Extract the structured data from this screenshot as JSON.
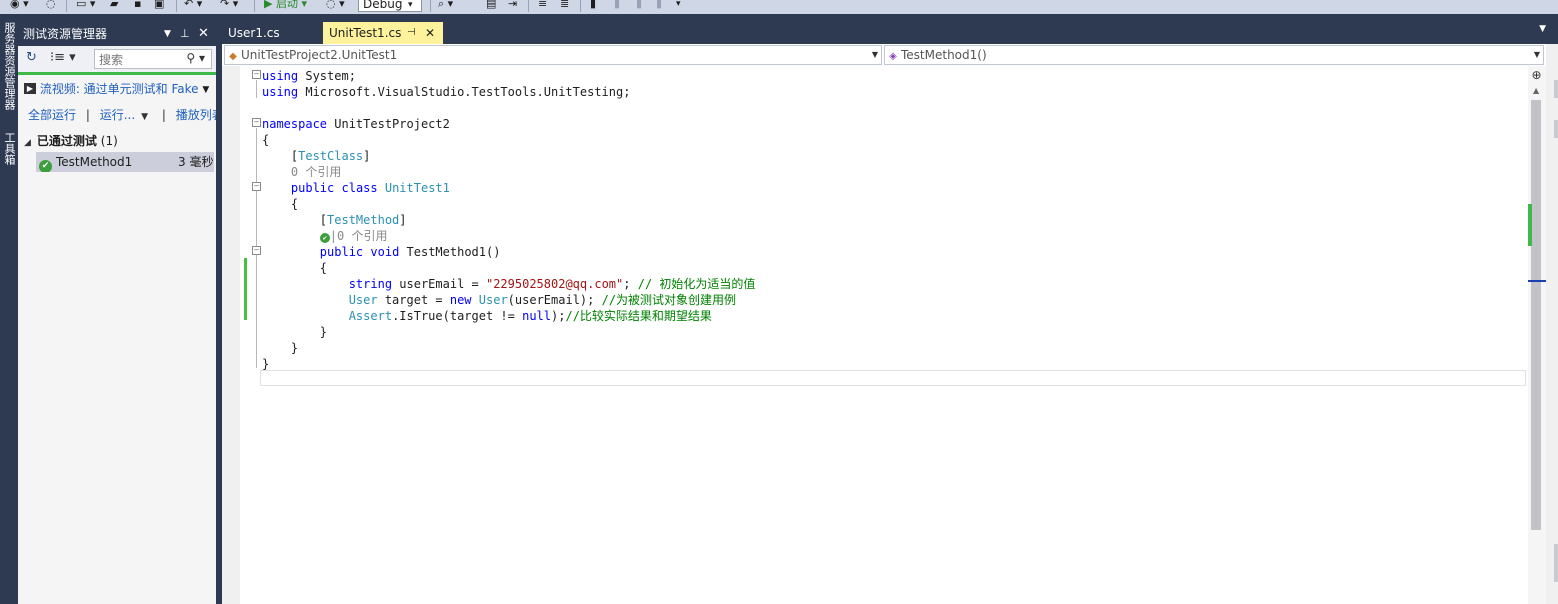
{
  "toolbar": {
    "start_label": "▶ 启动 ▾",
    "config_value": "Debug",
    "icons": [
      "back-icon",
      "refresh-icon",
      "new-project-icon",
      "open-icon",
      "save-icon",
      "save-all-icon",
      "undo-icon",
      "redo-icon",
      "start-icon",
      "attach-icon",
      "config-dropdown-icon",
      "find-icon",
      "layout-icon",
      "indent-icon",
      "outdent-icon",
      "bookmark-icon",
      "prev-bookmark-icon",
      "next-bookmark-icon"
    ]
  },
  "left_strip": {
    "tab1": "服务器资源管理器",
    "tab2": "工具箱"
  },
  "test_explorer": {
    "title": "测试资源管理器",
    "search_placeholder": "搜索",
    "playlist_label": "流视频: 通过单元测试和 Fake",
    "run_all": "全部运行",
    "run": "运行...",
    "playlist": "播放列表:",
    "group_name": "已通过测试",
    "group_count": "(1)",
    "test": {
      "name": "TestMethod1",
      "duration": "3 毫秒"
    }
  },
  "tabs": {
    "user1": "User1.cs",
    "unittest1": "UnitTest1.cs"
  },
  "nav": {
    "class": "UnitTestProject2.UnitTest1",
    "member": "TestMethod1()"
  },
  "code": {
    "l1_kw": "using",
    "l1_rest": " System;",
    "l2_kw": "using",
    "l2_rest": " Microsoft.VisualStudio.TestTools.UnitTesting;",
    "l4_kw": "namespace",
    "l4_rest": " UnitTestProject2",
    "l5": "{",
    "l6_attr": "TestClass",
    "l7_lens": "0 个引用",
    "l8_kw1": "public",
    "l8_kw2": "class",
    "l8_type": "UnitTest1",
    "l9": "{",
    "l10_attr": "TestMethod",
    "l11_lens": "0 个引用",
    "l12_kw1": "public",
    "l12_kw2": "void",
    "l12_rest": " TestMethod1()",
    "l13": "{",
    "l14_kw": "string",
    "l14_var": " userEmail = ",
    "l14_str": "\"2295025802@qq.com\"",
    "l14_semi": ";",
    "l14_cm": " // 初始化为适当的值",
    "l15_type": "User",
    "l15_mid": " target = ",
    "l15_kw": "new",
    "l15_type2": " User",
    "l15_rest": "(userEmail);",
    "l15_cm": " //为被测试对象创建用例",
    "l16_type": "Assert",
    "l16_mid": ".IsTrue(target != ",
    "l16_kw": "null",
    "l16_rest": ");",
    "l16_cm": "//比较实际结果和期望结果",
    "l17": "}",
    "l18": "}",
    "l19": "}"
  }
}
